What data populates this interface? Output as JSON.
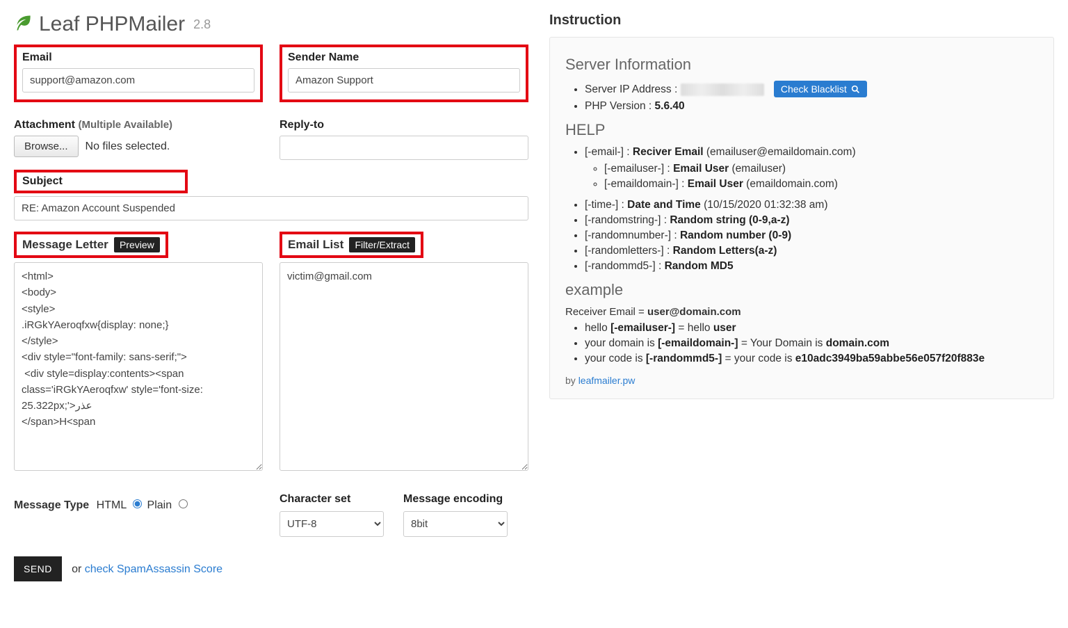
{
  "title": {
    "app": "Leaf PHPMailer",
    "version": "2.8"
  },
  "form": {
    "email_label": "Email",
    "email_value": "support@amazon.com",
    "sender_label": "Sender Name",
    "sender_value": "Amazon Support",
    "attachment_label": "Attachment",
    "attachment_sub": "(Multiple Available)",
    "browse_label": "Browse...",
    "nofiles": "No files selected.",
    "replyto_label": "Reply-to",
    "replyto_value": "",
    "subject_label": "Subject",
    "subject_value": "RE: Amazon Account Suspended",
    "msg_letter_label": "Message Letter",
    "preview_btn": "Preview",
    "email_list_label": "Email List",
    "filter_btn": "Filter/Extract",
    "msg_letter_value": "<html>\n<body>\n<style>\n.iRGkYAeroqfxw{display: none;}\n</style>\n<div style=\"font-family: sans-serif;\">\n <div style=display:contents><span class='iRGkYAeroqfxw' style='font-size: 25.322px;'>عذر\n</span>H<span",
    "email_list_value": "victim@gmail.com",
    "msg_type_label": "Message Type",
    "msg_type_html": "HTML",
    "msg_type_plain": "Plain",
    "charset_label": "Character set",
    "charset_value": "UTF-8",
    "encoding_label": "Message encoding",
    "encoding_value": "8bit",
    "send_label": "SEND",
    "or_text": "or ",
    "spam_link": "check SpamAssassin Score"
  },
  "info": {
    "instruction_heading": "Instruction",
    "server_heading": "Server Information",
    "server_ip_label": "Server IP Address :",
    "check_blacklist": "Check Blacklist",
    "php_label": "PHP Version : ",
    "php_value": "5.6.40",
    "help_heading": "HELP",
    "help_items": {
      "email_tag": "[-email-] : ",
      "email_bold": "Reciver Email",
      "email_paren": " (emailuser@emaildomain.com)",
      "emailuser_tag": "[-emailuser-] : ",
      "emailuser_bold": "Email User",
      "emailuser_paren": " (emailuser)",
      "emaildomain_tag": "[-emaildomain-] : ",
      "emaildomain_bold": "Email User",
      "emaildomain_paren": " (emaildomain.com)",
      "time_tag": "[-time-] : ",
      "time_bold": "Date and Time",
      "time_paren": " (10/15/2020 01:32:38 am)",
      "rs_tag": "[-randomstring-] : ",
      "rs_bold": "Random string (0-9,a-z)",
      "rn_tag": "[-randomnumber-] : ",
      "rn_bold": "Random number (0-9)",
      "rl_tag": "[-randomletters-] : ",
      "rl_bold": "Random Letters(a-z)",
      "rm_tag": "[-randommd5-] : ",
      "rm_bold": "Random MD5"
    },
    "example_heading": "example",
    "example_receiver_label": "Receiver Email = ",
    "example_receiver_value": "user@domain.com",
    "ex1_a": "hello ",
    "ex1_b": "[-emailuser-]",
    "ex1_c": " = hello ",
    "ex1_d": "user",
    "ex2_a": "your domain is ",
    "ex2_b": "[-emaildomain-]",
    "ex2_c": " = Your Domain is ",
    "ex2_d": "domain.com",
    "ex3_a": "your code is ",
    "ex3_b": "[-randommd5-]",
    "ex3_c": " = your code is ",
    "ex3_d": "e10adc3949ba59abbe56e057f20f883e",
    "by_label": "by ",
    "by_link": "leafmailer.pw"
  }
}
